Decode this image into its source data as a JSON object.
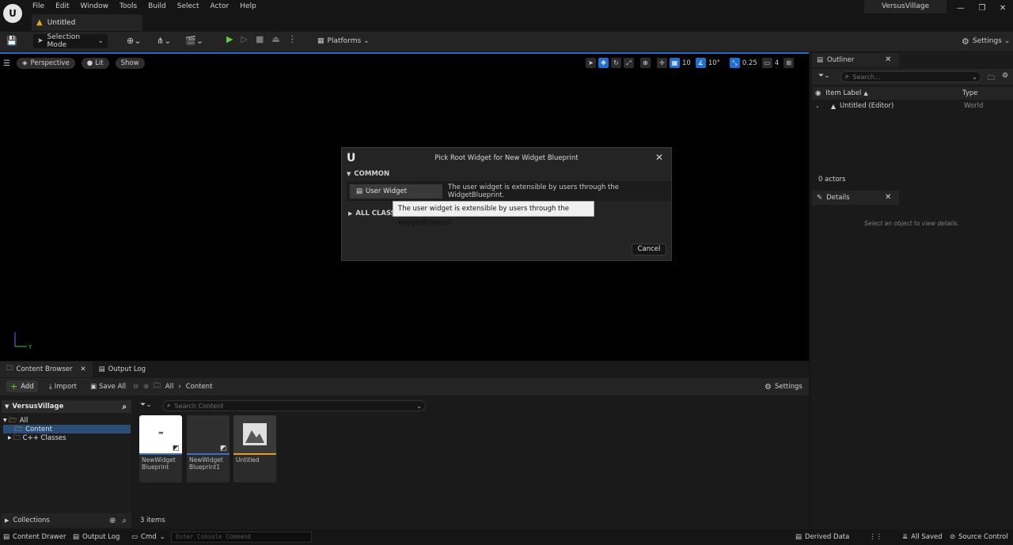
{
  "menu": {
    "items": [
      "File",
      "Edit",
      "Window",
      "Tools",
      "Build",
      "Select",
      "Actor",
      "Help"
    ],
    "document_tab": "Untitled",
    "project_name": "VersusVillage"
  },
  "toolbar": {
    "selection_mode": "Selection Mode",
    "platforms": "Platforms",
    "settings": "Settings"
  },
  "viewport": {
    "perspective": "Perspective",
    "lit": "Lit",
    "show": "Show",
    "grid_snap": "10",
    "rotation_snap": "10°",
    "scale_snap": "0.25",
    "camera_speed": "4",
    "axis_y": "Y"
  },
  "dialog": {
    "logo": "U",
    "title": "Pick Root Widget for New Widget Blueprint",
    "common_header": "COMMON",
    "user_widget_label": "User Widget",
    "user_widget_desc": "The user widget is extensible by users through the WidgetBlueprint.",
    "all_classes_header": "ALL CLASSES",
    "tooltip": "The user widget is extensible by users through the WidgetBlueprint.",
    "cancel": "Cancel"
  },
  "outliner": {
    "tab": "Outliner",
    "search_placeholder": "Search...",
    "col_label": "Item Label",
    "col_type": "Type",
    "row_label": "Untitled (Editor)",
    "row_type": "World",
    "actors_count": "0 actors"
  },
  "details": {
    "tab": "Details",
    "hint": "Select an object to view details."
  },
  "content_browser": {
    "tab": "Content Browser",
    "output_tab": "Output Log",
    "add": "Add",
    "import": "Import",
    "save_all": "Save All",
    "crumb_all": "All",
    "crumb_content": "Content",
    "settings": "Settings",
    "sources_header": "VersusVillage",
    "tree": [
      "All",
      "Content",
      "C++ Classes"
    ],
    "collections": "Collections",
    "search_placeholder": "Search Content",
    "assets": [
      {
        "name": "NewWidget Blueprint",
        "thumb_color": "#ffffff",
        "bar_color": "#3a6ec8"
      },
      {
        "name": "NewWidget Blueprint1",
        "thumb_color": "#2f2f2f",
        "bar_color": "#3a6ec8"
      },
      {
        "name": "Untitled",
        "thumb_color": "#3a3a3a",
        "bar_color": "#e59a1a"
      }
    ],
    "items_count": "3 items"
  },
  "statusbar": {
    "content_drawer": "Content Drawer",
    "output_log": "Output Log",
    "cmd": "Cmd",
    "console_placeholder": "Enter Console Command",
    "derived_data": "Derived Data",
    "all_saved": "All Saved",
    "source_control": "Source Control"
  }
}
